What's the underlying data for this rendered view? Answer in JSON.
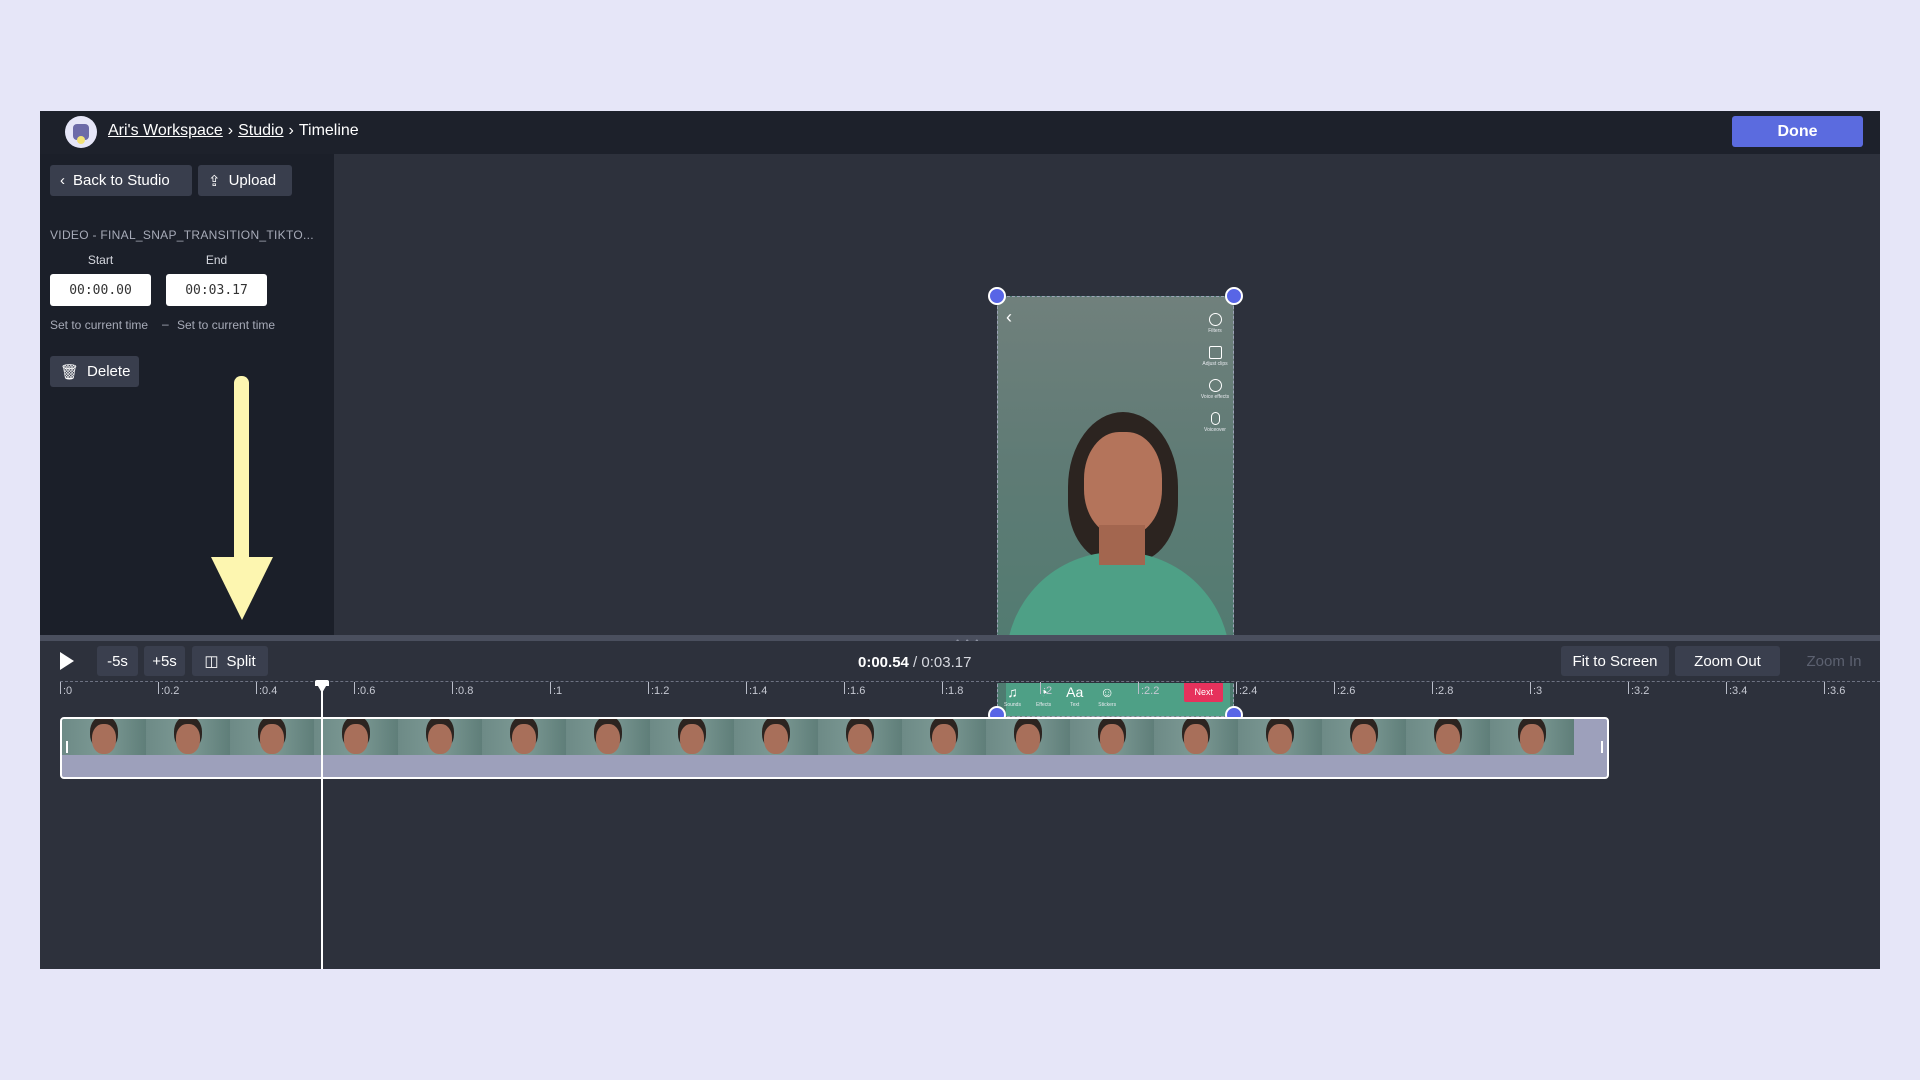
{
  "header": {
    "breadcrumb": [
      "Ari's Workspace",
      "Studio",
      "Timeline"
    ],
    "separator": "›",
    "done_label": "Done"
  },
  "sidebar": {
    "back_label": "Back to Studio",
    "upload_label": "Upload",
    "video_name": "VIDEO - FINAL_SNAP_TRANSITION_TIKTO...",
    "start_label": "Start",
    "end_label": "End",
    "start_value": "00:00.00",
    "end_value": "00:03.17",
    "set_current_start": "Set to current time",
    "set_current_end": "Set to current time",
    "delete_label": "Delete"
  },
  "preview": {
    "next_label": "Next",
    "side_tools": [
      "Filters",
      "Adjust clips",
      "Voice effects",
      "Voiceover"
    ],
    "bottom_tools": [
      {
        "icon": "♫",
        "label": "Sounds"
      },
      {
        "icon": "◔",
        "label": "Effects"
      },
      {
        "icon": "Aa",
        "label": "Text"
      },
      {
        "icon": "☺",
        "label": "Stickers"
      }
    ]
  },
  "controls": {
    "minus5": "-5s",
    "plus5": "+5s",
    "split": "Split",
    "current_time": "0:00.54",
    "total_time": "0:03.17",
    "time_sep": " / ",
    "fit_label": "Fit to Screen",
    "zoom_out_label": "Zoom Out",
    "zoom_in_label": "Zoom In"
  },
  "timeline": {
    "ticks": [
      ":0",
      ":0.2",
      ":0.4",
      ":0.6",
      ":0.8",
      ":1",
      ":1.2",
      ":1.4",
      ":1.6",
      ":1.8",
      ":2",
      ":2.2",
      ":2.4",
      ":2.6",
      ":2.8",
      ":3",
      ":3.2",
      ":3.4",
      ":3.6"
    ],
    "clip_duration": 3.17,
    "playhead_seconds": 0.54,
    "thumbnail_count": 18
  },
  "colors": {
    "accent": "#5b6bdf",
    "next_button": "#e6325c",
    "arrow": "#fdf6b0"
  }
}
